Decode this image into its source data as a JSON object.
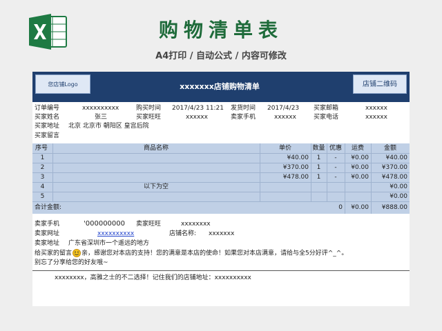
{
  "banner": {
    "title": "购物清单表",
    "subtitle": "A4打印 / 自动公式 / 内容可修改",
    "excel_icon": "excel-icon",
    "excel_color": "#1e7a43"
  },
  "sheet": {
    "logo_label": "您店铺Logo",
    "title": "xxxxxxx店铺购物清单",
    "qr_label": "店铺二维码",
    "header_color": "#1f3f6e",
    "table_color": "#c0d0e6"
  },
  "order": {
    "order_no_label": "订单编号",
    "order_no": "xxxxxxxxxx",
    "buy_time_label": "购买时间",
    "buy_time": "2017/4/23 11:21",
    "ship_time_label": "发货时间",
    "ship_time": "2017/4/23",
    "buyer_email_label": "买家邮箱",
    "buyer_email": "xxxxxx",
    "buyer_name_label": "买家姓名",
    "buyer_name": "张三",
    "buyer_ww_label": "买家旺旺",
    "buyer_ww": "xxxxxx",
    "buyer_mobile_label": "卖家手机",
    "buyer_mobile": "xxxxxx",
    "buyer_phone_label": "买家电话",
    "buyer_phone": "xxxxxx",
    "buyer_addr_label": "买家地址",
    "buyer_addr": "北京 北京市 朝阳区 皇宫后院",
    "buyer_msg_label": "买家留言"
  },
  "table": {
    "headers": {
      "no": "序号",
      "name": "商品名称",
      "price": "单价",
      "qty": "数量",
      "discount": "优惠",
      "freight": "运费",
      "amount": "金额"
    },
    "rows": [
      {
        "no": "1",
        "name": "",
        "price": "¥40.00",
        "qty": "1",
        "discount": "-",
        "freight": "¥0.00",
        "amount": "¥40.00"
      },
      {
        "no": "2",
        "name": "",
        "price": "¥370.00",
        "qty": "1",
        "discount": "-",
        "freight": "¥0.00",
        "amount": "¥370.00"
      },
      {
        "no": "3",
        "name": "",
        "price": "¥478.00",
        "qty": "1",
        "discount": "-",
        "freight": "¥0.00",
        "amount": "¥478.00"
      },
      {
        "no": "4",
        "name": "以下为空",
        "price": "",
        "qty": "",
        "discount": "",
        "freight": "",
        "amount": "¥0.00"
      },
      {
        "no": "5",
        "name": "",
        "price": "",
        "qty": "",
        "discount": "",
        "freight": "",
        "amount": "¥0.00"
      }
    ],
    "total": {
      "label": "合计金额:",
      "qty": "0",
      "freight": "¥0.00",
      "amount": "¥888.00"
    }
  },
  "seller": {
    "mobile_label": "卖家手机",
    "mobile": "'000000000",
    "ww_label": "卖家旺旺",
    "ww": "xxxxxxxx",
    "site_label": "卖家网址",
    "site": "xxxxxxxxxx",
    "shop_label": "店铺名称:",
    "shop": "xxxxxxx",
    "addr_label": "卖家地址",
    "addr": "广东省深圳市一个遥远的地方",
    "msg_label": "给买家的留言",
    "msg_text": "亲，感谢您对本店的支持！您的满意是本店的使命！如果您对本店满意，请给与全5分好评^_^。",
    "msg_line2": "别忘了分享给您的好友哦~",
    "smile_icon": "smiley-icon"
  },
  "footer": {
    "text": "xxxxxxxx，高雅之士的不二选择！记住我们的店铺地址：xxxxxxxxxx"
  }
}
